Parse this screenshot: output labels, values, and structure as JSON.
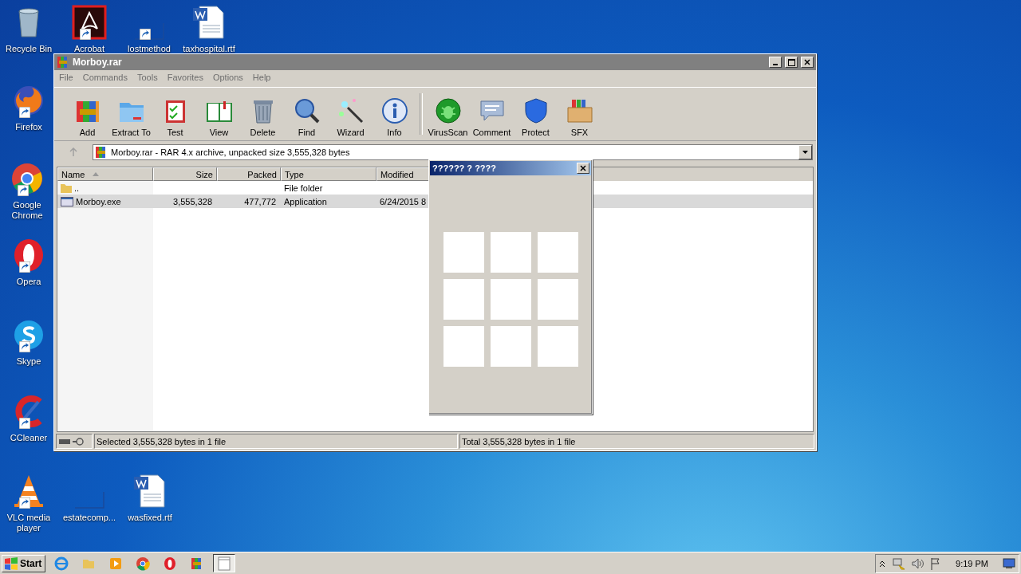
{
  "desktop_icons": [
    {
      "label": "Recycle Bin",
      "kind": "recycle"
    },
    {
      "label": "Acrobat",
      "kind": "pdf"
    },
    {
      "label": "lostmethod",
      "kind": "blank"
    },
    {
      "label": "taxhospital.rtf",
      "kind": "word"
    },
    {
      "label": "Firefox",
      "kind": "firefox"
    },
    {
      "label": "Google Chrome",
      "kind": "chrome"
    },
    {
      "label": "Opera",
      "kind": "opera"
    },
    {
      "label": "Skype",
      "kind": "skype"
    },
    {
      "label": "CCleaner",
      "kind": "ccleaner"
    },
    {
      "label": "VLC media player",
      "kind": "vlc"
    },
    {
      "label": "estatecomp...",
      "kind": "blank"
    },
    {
      "label": "wasfixed.rtf",
      "kind": "word"
    }
  ],
  "window": {
    "title": "Morboy.rar",
    "menu": [
      "File",
      "Commands",
      "Tools",
      "Favorites",
      "Options",
      "Help"
    ],
    "toolbar": [
      {
        "label": "Add",
        "kind": "add"
      },
      {
        "label": "Extract To",
        "kind": "extract"
      },
      {
        "label": "Test",
        "kind": "test"
      },
      {
        "label": "View",
        "kind": "view"
      },
      {
        "label": "Delete",
        "kind": "delete"
      },
      {
        "label": "Find",
        "kind": "find"
      },
      {
        "label": "Wizard",
        "kind": "wizard"
      },
      {
        "label": "Info",
        "kind": "info"
      },
      {
        "label": "VirusScan",
        "kind": "virus"
      },
      {
        "label": "Comment",
        "kind": "comment"
      },
      {
        "label": "Protect",
        "kind": "protect"
      },
      {
        "label": "SFX",
        "kind": "sfx"
      }
    ],
    "address": "Morboy.rar - RAR 4.x archive, unpacked size 3,555,328 bytes",
    "columns": [
      "Name",
      "Size",
      "Packed",
      "Type",
      "Modified"
    ],
    "rows": [
      {
        "kind": "folder",
        "name": "..",
        "type": "File folder",
        "selected": false
      },
      {
        "kind": "exe",
        "name": "Morboy.exe",
        "size": "3,555,328",
        "packed": "477,772",
        "type": "Application",
        "modified": "6/24/2015 8",
        "selected": true
      }
    ],
    "status_left": "Selected 3,555,328 bytes in 1 file",
    "status_right": "Total 3,555,328 bytes in 1 file"
  },
  "dialog": {
    "title": "?????? ? ????"
  },
  "taskbar": {
    "start": "Start",
    "apps": [
      {
        "kind": "ie",
        "selected": false
      },
      {
        "kind": "explorer",
        "selected": false
      },
      {
        "kind": "media",
        "selected": false
      },
      {
        "kind": "chrome",
        "selected": false
      },
      {
        "kind": "opera",
        "selected": false
      },
      {
        "kind": "winrar",
        "selected": false
      },
      {
        "kind": "window",
        "selected": true
      }
    ],
    "clock": "9:19 PM"
  }
}
